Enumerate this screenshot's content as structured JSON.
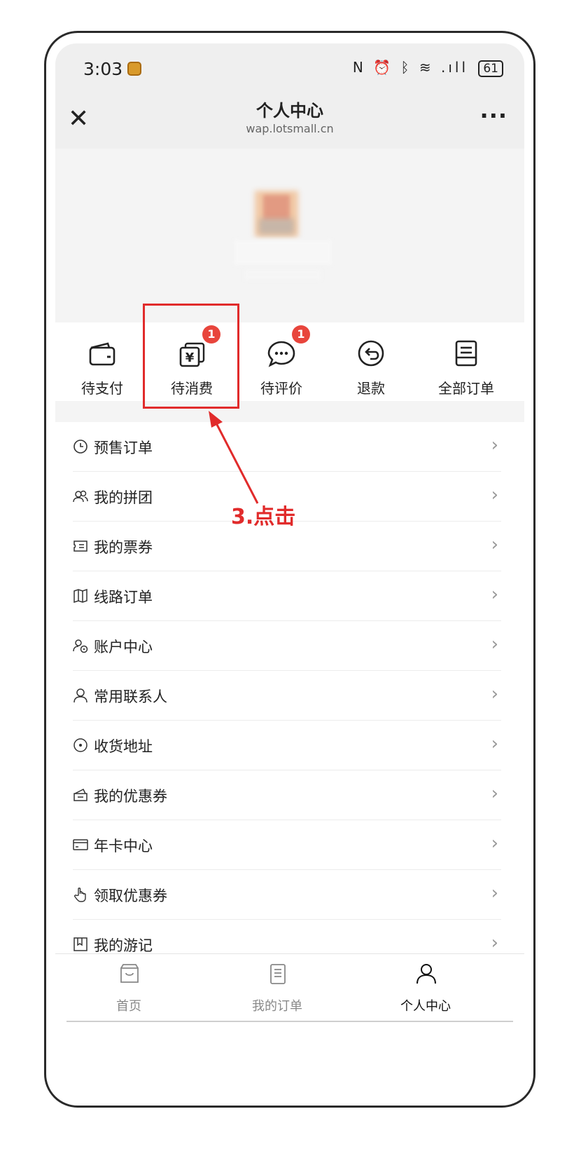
{
  "status_bar": {
    "time": "3:03",
    "battery": "61"
  },
  "title_bar": {
    "title": "个人中心",
    "url": "wap.lotsmall.cn",
    "close_icon": "close-icon",
    "more_icon": "more-icon"
  },
  "order_shortcuts": [
    {
      "label": "待支付",
      "icon": "wallet-icon",
      "badge": ""
    },
    {
      "label": "待消费",
      "icon": "voucher-yuan-icon",
      "badge": "1"
    },
    {
      "label": "待评价",
      "icon": "comment-icon",
      "badge": "1"
    },
    {
      "label": "退款",
      "icon": "refund-icon",
      "badge": ""
    },
    {
      "label": "全部订单",
      "icon": "order-list-icon",
      "badge": ""
    }
  ],
  "menu": [
    {
      "label": "预售订单",
      "icon": "clock-icon"
    },
    {
      "label": "我的拼团",
      "icon": "group-icon"
    },
    {
      "label": "我的票券",
      "icon": "ticket-icon"
    },
    {
      "label": "线路订单",
      "icon": "map-icon"
    },
    {
      "label": "账户中心",
      "icon": "account-icon"
    },
    {
      "label": "常用联系人",
      "icon": "contact-icon"
    },
    {
      "label": "收货地址",
      "icon": "location-icon"
    },
    {
      "label": "我的优惠券",
      "icon": "coupon-icon"
    },
    {
      "label": "年卡中心",
      "icon": "card-icon"
    },
    {
      "label": "领取优惠券",
      "icon": "hand-icon"
    },
    {
      "label": "我的游记",
      "icon": "travel-note-icon"
    }
  ],
  "tab_bar": [
    {
      "label": "首页",
      "icon": "home-icon",
      "active": false
    },
    {
      "label": "我的订单",
      "icon": "orders-icon",
      "active": false
    },
    {
      "label": "个人中心",
      "icon": "user-icon",
      "active": true
    }
  ],
  "annotation": {
    "text": "3.点击",
    "color": "#e12b2b"
  },
  "colors": {
    "badge": "#e8453c",
    "header_bg": "#efefef",
    "profile_bg": "#f4f4f4"
  }
}
